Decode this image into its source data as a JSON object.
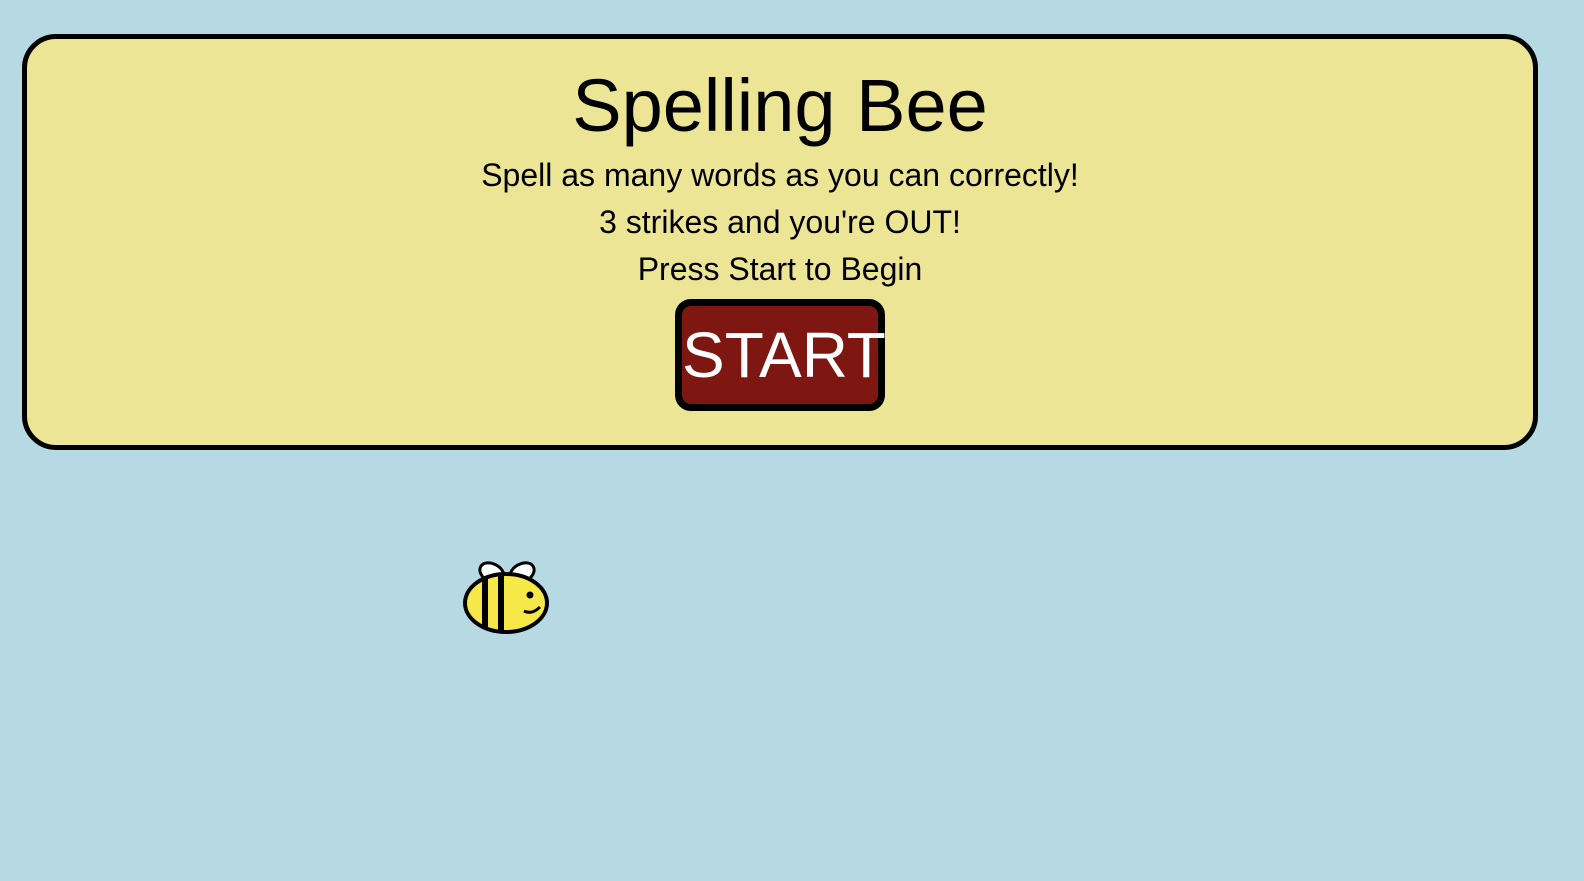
{
  "panel": {
    "title": "Spelling Bee",
    "lines": [
      "Spell as many words as you can correctly!",
      "3 strikes and you're OUT!",
      "Press Start to Begin"
    ],
    "start_label": "START"
  },
  "colors": {
    "sky": "#b7d9e4",
    "panel": "#ece596",
    "start_button": "#7e1611",
    "bee_body": "#f7e84a"
  },
  "sprites": {
    "player": "bee-icon"
  }
}
